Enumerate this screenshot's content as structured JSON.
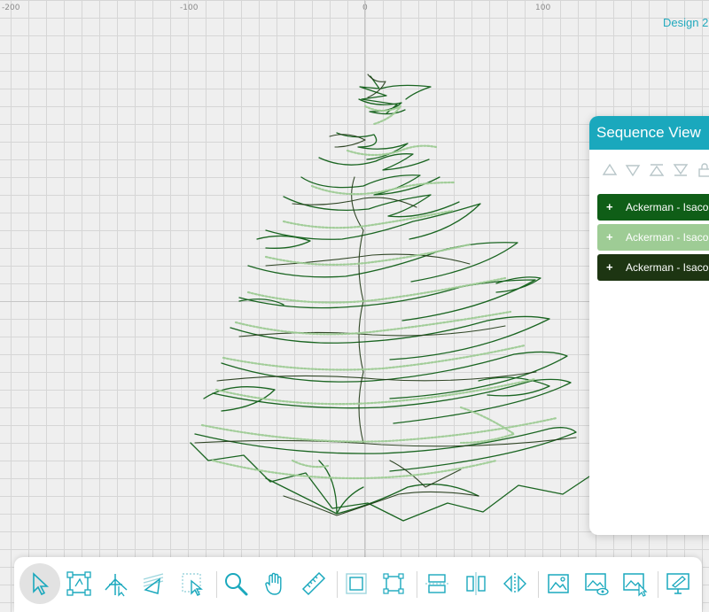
{
  "ruler": {
    "labels": [
      "-200",
      "-100",
      "0",
      "100"
    ]
  },
  "design": {
    "title": "Design 2"
  },
  "sequence_view": {
    "title": "Sequence View",
    "toolbar_icons": [
      "move-up-icon",
      "move-down-icon",
      "move-top-icon",
      "move-bottom-icon",
      "lock-icon"
    ],
    "rows": [
      {
        "label": "Ackerman - Isacord",
        "color": "#0f5e17"
      },
      {
        "label": "Ackerman - Isacord",
        "color": "#9ecc95"
      },
      {
        "label": "Ackerman - Isacord",
        "color": "#1d3512"
      }
    ]
  },
  "toolbar": {
    "icons": [
      "select-arrow-icon",
      "transform-box-icon",
      "node-edit-icon",
      "stitch-direction-icon",
      "freehand-select-icon",
      "zoom-icon",
      "pan-hand-icon",
      "ruler-icon",
      "group-icon",
      "ungroup-icon",
      "align-horizontal-icon",
      "align-vertical-icon",
      "mirror-icon",
      "image-icon",
      "image-visibility-icon",
      "image-select-icon",
      "monitor-draw-icon"
    ]
  },
  "colors": {
    "accent": "#1aa8bd",
    "thread_dark_green": "#0f5e17",
    "thread_light_green": "#9ecc95",
    "thread_very_dark": "#1d3512"
  }
}
